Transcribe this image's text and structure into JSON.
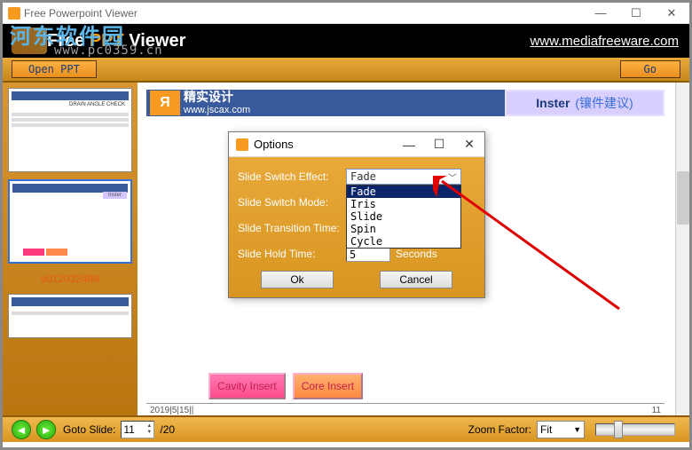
{
  "window": {
    "title": "Free Powerpoint Viewer",
    "min": "—",
    "max": "☐",
    "close": "✕"
  },
  "watermark": {
    "text": "河东软件园",
    "url": "www.pc0359.cn"
  },
  "header": {
    "title_a": "Free ",
    "title_b": "PPT",
    "title_c": " Viewer",
    "url": "www.mediafreeware.com"
  },
  "toolbar": {
    "open": "Open PPT",
    "go": "Go"
  },
  "thumbs": {
    "t1_text": "DRAIN ANGLE CHECK",
    "t2_inster": "Inster",
    "slide_number": "s012032489"
  },
  "slide": {
    "logo_cn": "精实设计",
    "logo_url": "www.jscax.com",
    "inster": "Inster",
    "inster_sub": "(镶件建议)",
    "cavity": "Cavity Insert",
    "core": "Core Insert",
    "date": "2019|5|15||",
    "page_num": "11"
  },
  "dialog": {
    "title": "Options",
    "min": "—",
    "max": "☐",
    "close": "✕",
    "label_effect": "Slide Switch Effect:",
    "label_mode": "Slide Switch Mode:",
    "label_transition": "Slide Transition Time:",
    "label_hold": "Slide Hold Time:",
    "effect_value": "Fade",
    "options": [
      "Fade",
      "Iris",
      "Slide",
      "Spin",
      "Cycle"
    ],
    "hold_value": "5",
    "seconds": "Seconds",
    "ok": "Ok",
    "cancel": "Cancel"
  },
  "bottom": {
    "goto_label": "Goto Slide:",
    "goto_value": "11",
    "total": "/20",
    "zoom_label": "Zoom Factor:",
    "zoom_value": "Fit"
  }
}
